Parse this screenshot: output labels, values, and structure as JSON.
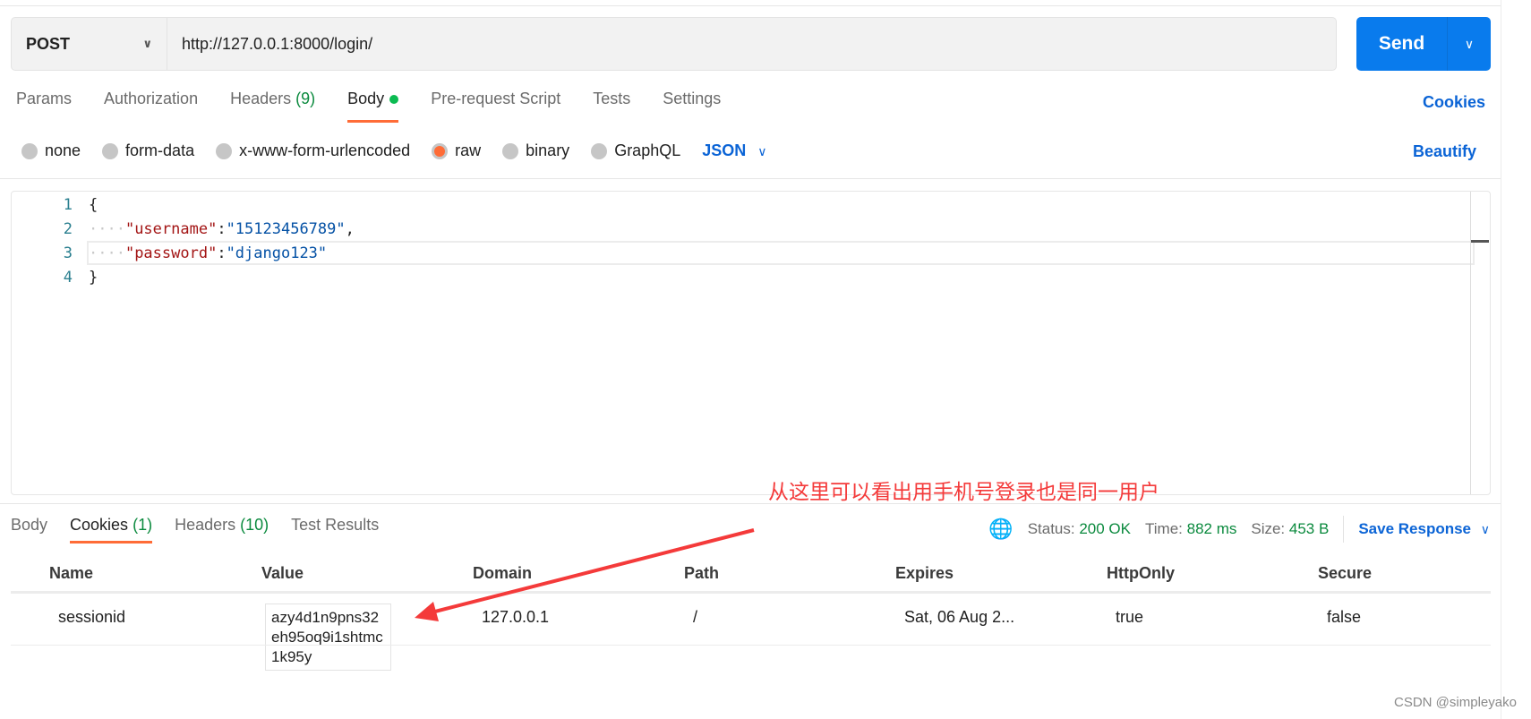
{
  "request": {
    "method": "POST",
    "url": "http://127.0.0.1:8000/login/",
    "send_label": "Send"
  },
  "req_tabs": [
    {
      "label": "Params"
    },
    {
      "label": "Authorization"
    },
    {
      "label": "Headers",
      "count": "(9)"
    },
    {
      "label": "Body"
    },
    {
      "label": "Pre-request Script"
    },
    {
      "label": "Tests"
    },
    {
      "label": "Settings"
    }
  ],
  "cookies_link": "Cookies",
  "body_types": [
    {
      "label": "none"
    },
    {
      "label": "form-data"
    },
    {
      "label": "x-www-form-urlencoded"
    },
    {
      "label": "raw",
      "selected": true
    },
    {
      "label": "binary"
    },
    {
      "label": "GraphQL"
    }
  ],
  "format": "JSON",
  "beautify": "Beautify",
  "editor": {
    "line_numbers": [
      "1",
      "2",
      "3",
      "4"
    ],
    "open_brace": "{",
    "close_brace": "}",
    "k1": "\"username\"",
    "v1": "\"15123456789\"",
    "k2": "\"password\"",
    "v2": "\"django123\"",
    "colon": ":",
    "comma": ",",
    "indent": "····"
  },
  "annotation": "从这里可以看出用手机号登录也是同一用户",
  "resp_tabs": [
    {
      "label": "Body"
    },
    {
      "label": "Cookies",
      "count": "(1)"
    },
    {
      "label": "Headers",
      "count": "(10)"
    },
    {
      "label": "Test Results"
    }
  ],
  "status": {
    "status_label": "Status:",
    "status": "200 OK",
    "time_label": "Time:",
    "time": "882 ms",
    "size_label": "Size:",
    "size": "453 B",
    "save": "Save Response"
  },
  "table": {
    "headers": [
      "Name",
      "Value",
      "Domain",
      "Path",
      "Expires",
      "HttpOnly",
      "Secure"
    ],
    "row": {
      "name": "sessionid",
      "value": "azy4d1n9pns32eh95oq9i1shtmc1k95y",
      "domain": "127.0.0.1",
      "path": "/",
      "expires": "Sat, 06 Aug 2...",
      "httponly": "true",
      "secure": "false"
    }
  },
  "watermark": "CSDN @simpleyako",
  "colors": {
    "accent": "#097bed",
    "tab_underline": "#ff6c37",
    "link": "#0b64d6",
    "annotation": "#f43a3a"
  }
}
